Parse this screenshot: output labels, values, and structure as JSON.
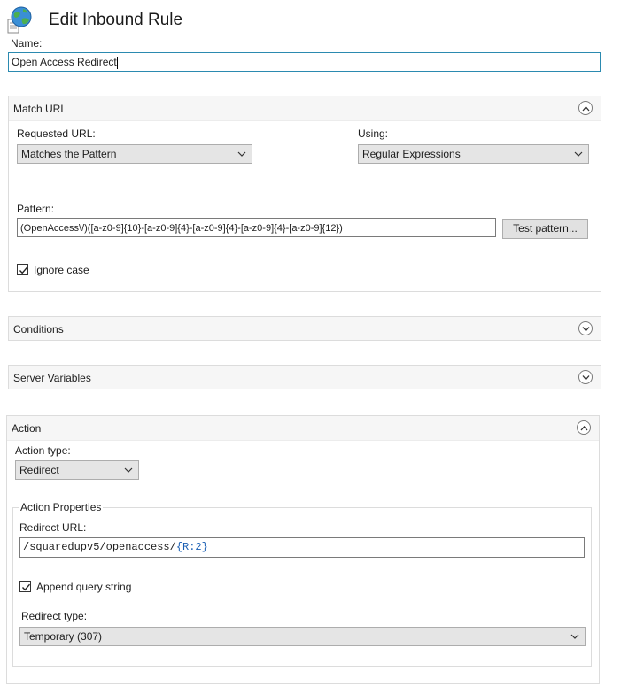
{
  "header": {
    "title": "Edit Inbound Rule",
    "icon": "globe-document-icon"
  },
  "name_field": {
    "label": "Name:",
    "value": "Open Access Redirect"
  },
  "match_url": {
    "title": "Match URL",
    "requested_url_label": "Requested URL:",
    "requested_url_value": "Matches the Pattern",
    "using_label": "Using:",
    "using_value": "Regular Expressions",
    "pattern_label": "Pattern:",
    "pattern_value": "(OpenAccess\\/)([a-z0-9]{10}-[a-z0-9]{4}-[a-z0-9]{4}-[a-z0-9]{4}-[a-z0-9]{12})",
    "test_pattern_button": "Test pattern...",
    "ignore_case_label": "Ignore case",
    "ignore_case_checked": true
  },
  "conditions": {
    "title": "Conditions"
  },
  "server_variables": {
    "title": "Server Variables"
  },
  "action": {
    "title": "Action",
    "action_type_label": "Action type:",
    "action_type_value": "Redirect",
    "properties_title": "Action Properties",
    "redirect_url_label": "Redirect URL:",
    "redirect_url_prefix": "/squaredupv5/openaccess/",
    "redirect_url_open_brace": "{",
    "redirect_url_var": "R:2",
    "redirect_url_close_brace": "}",
    "append_query_label": "Append query string",
    "append_query_checked": true,
    "redirect_type_label": "Redirect type:",
    "redirect_type_value": "Temporary (307)"
  },
  "colors": {
    "focus_border": "#2b8ab0",
    "section_header_bg": "#f6f6f6",
    "combo_bg": "#e5e5e5",
    "regex_variable": "#1a5fb4"
  }
}
